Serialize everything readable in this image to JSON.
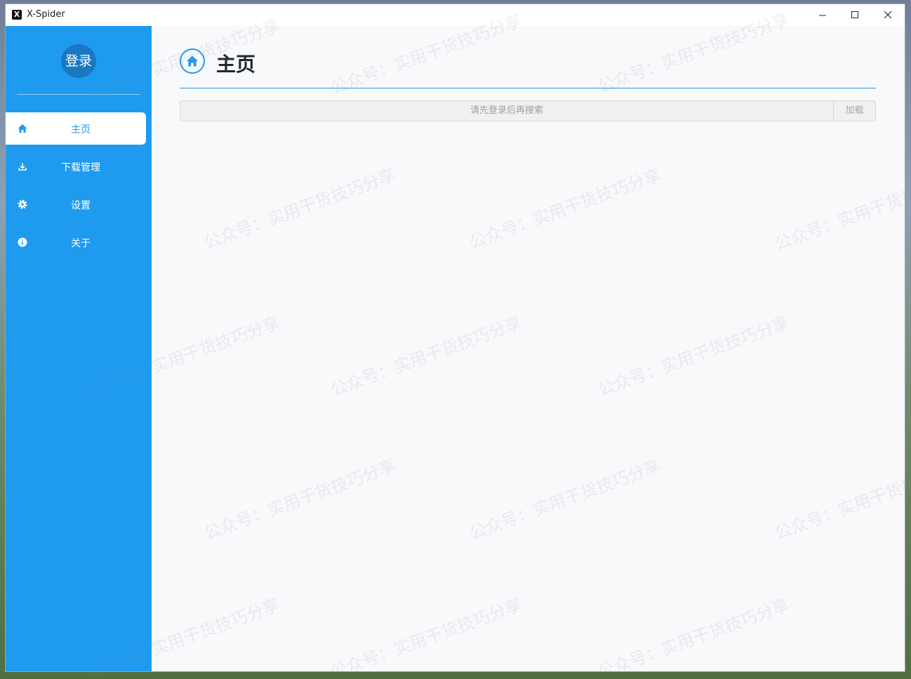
{
  "window": {
    "title": "X-Spider",
    "app_icon": "X"
  },
  "sidebar": {
    "login_label": "登录",
    "items": [
      {
        "label": "主页",
        "icon": "home-icon",
        "active": true
      },
      {
        "label": "下载管理",
        "icon": "download-icon",
        "active": false
      },
      {
        "label": "设置",
        "icon": "gear-icon",
        "active": false
      },
      {
        "label": "关于",
        "icon": "info-icon",
        "active": false
      }
    ]
  },
  "main": {
    "title": "主页",
    "search": {
      "placeholder": "请先登录后再搜索"
    },
    "load_label": "加载"
  },
  "watermark": {
    "text": "公众号：实用干货技巧分享"
  },
  "colors": {
    "accent": "#1e9bef",
    "avatar": "#1a78c0",
    "content_bg": "#f7f9fb"
  }
}
